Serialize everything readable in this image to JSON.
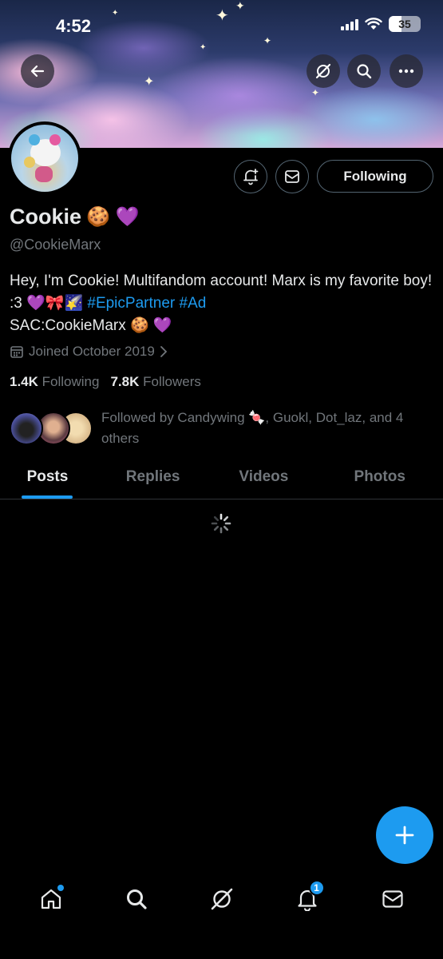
{
  "status_bar": {
    "time": "4:52",
    "battery": "35"
  },
  "profile": {
    "name": "Cookie",
    "name_emojis": "🍪 💜",
    "handle": "@CookieMarx",
    "bio_text": "Hey, I'm Cookie! Multifandom account! Marx is my favorite boy! :3 💜🎀🌠 ",
    "bio_tag1": "#EpicPartner",
    "bio_tag2": "#Ad",
    "bio_line2": "SAC:CookieMarx 🍪 💜",
    "joined": "Joined October 2019",
    "following_count": "1.4K",
    "following_label": "Following",
    "followers_count": "7.8K",
    "followers_label": "Followers",
    "followed_by": "Followed by Candywing 🍬, Guokl, Dot_laz, and 4 others"
  },
  "actions": {
    "following_button": "Following"
  },
  "tabs": [
    {
      "label": "Posts",
      "active": true
    },
    {
      "label": "Replies",
      "active": false
    },
    {
      "label": "Videos",
      "active": false
    },
    {
      "label": "Photos",
      "active": false
    }
  ],
  "bottom_nav": {
    "notifications_badge": "1"
  },
  "colors": {
    "accent": "#1d9bf0",
    "background": "#000000",
    "muted": "#71767b"
  },
  "icons": [
    "back-arrow-icon",
    "grok-icon",
    "search-icon",
    "more-icon",
    "notification-bell-plus-icon",
    "mail-icon",
    "calendar-icon",
    "chevron-right-icon",
    "spinner-icon",
    "plus-icon",
    "home-icon",
    "search-nav-icon",
    "grok-nav-icon",
    "bell-icon",
    "mail-nav-icon"
  ]
}
